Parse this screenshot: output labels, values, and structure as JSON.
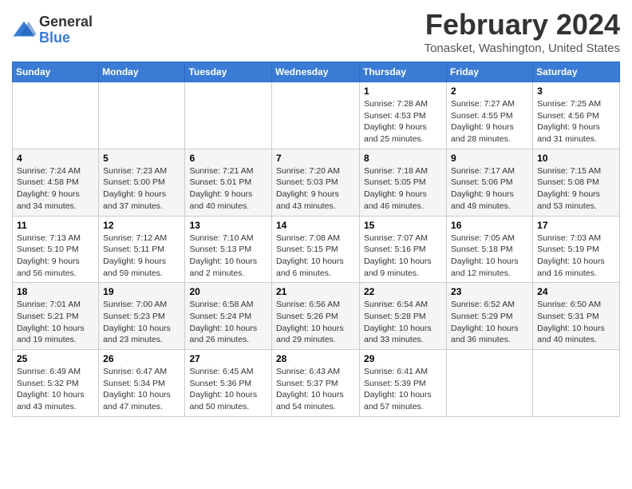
{
  "header": {
    "logo_general": "General",
    "logo_blue": "Blue",
    "month_title": "February 2024",
    "location": "Tonasket, Washington, United States"
  },
  "weekdays": [
    "Sunday",
    "Monday",
    "Tuesday",
    "Wednesday",
    "Thursday",
    "Friday",
    "Saturday"
  ],
  "weeks": [
    [
      {
        "day": "",
        "sunrise": "",
        "sunset": "",
        "daylight": ""
      },
      {
        "day": "",
        "sunrise": "",
        "sunset": "",
        "daylight": ""
      },
      {
        "day": "",
        "sunrise": "",
        "sunset": "",
        "daylight": ""
      },
      {
        "day": "",
        "sunrise": "",
        "sunset": "",
        "daylight": ""
      },
      {
        "day": "1",
        "sunrise": "Sunrise: 7:28 AM",
        "sunset": "Sunset: 4:53 PM",
        "daylight": "Daylight: 9 hours and 25 minutes."
      },
      {
        "day": "2",
        "sunrise": "Sunrise: 7:27 AM",
        "sunset": "Sunset: 4:55 PM",
        "daylight": "Daylight: 9 hours and 28 minutes."
      },
      {
        "day": "3",
        "sunrise": "Sunrise: 7:25 AM",
        "sunset": "Sunset: 4:56 PM",
        "daylight": "Daylight: 9 hours and 31 minutes."
      }
    ],
    [
      {
        "day": "4",
        "sunrise": "Sunrise: 7:24 AM",
        "sunset": "Sunset: 4:58 PM",
        "daylight": "Daylight: 9 hours and 34 minutes."
      },
      {
        "day": "5",
        "sunrise": "Sunrise: 7:23 AM",
        "sunset": "Sunset: 5:00 PM",
        "daylight": "Daylight: 9 hours and 37 minutes."
      },
      {
        "day": "6",
        "sunrise": "Sunrise: 7:21 AM",
        "sunset": "Sunset: 5:01 PM",
        "daylight": "Daylight: 9 hours and 40 minutes."
      },
      {
        "day": "7",
        "sunrise": "Sunrise: 7:20 AM",
        "sunset": "Sunset: 5:03 PM",
        "daylight": "Daylight: 9 hours and 43 minutes."
      },
      {
        "day": "8",
        "sunrise": "Sunrise: 7:18 AM",
        "sunset": "Sunset: 5:05 PM",
        "daylight": "Daylight: 9 hours and 46 minutes."
      },
      {
        "day": "9",
        "sunrise": "Sunrise: 7:17 AM",
        "sunset": "Sunset: 5:06 PM",
        "daylight": "Daylight: 9 hours and 49 minutes."
      },
      {
        "day": "10",
        "sunrise": "Sunrise: 7:15 AM",
        "sunset": "Sunset: 5:08 PM",
        "daylight": "Daylight: 9 hours and 53 minutes."
      }
    ],
    [
      {
        "day": "11",
        "sunrise": "Sunrise: 7:13 AM",
        "sunset": "Sunset: 5:10 PM",
        "daylight": "Daylight: 9 hours and 56 minutes."
      },
      {
        "day": "12",
        "sunrise": "Sunrise: 7:12 AM",
        "sunset": "Sunset: 5:11 PM",
        "daylight": "Daylight: 9 hours and 59 minutes."
      },
      {
        "day": "13",
        "sunrise": "Sunrise: 7:10 AM",
        "sunset": "Sunset: 5:13 PM",
        "daylight": "Daylight: 10 hours and 2 minutes."
      },
      {
        "day": "14",
        "sunrise": "Sunrise: 7:08 AM",
        "sunset": "Sunset: 5:15 PM",
        "daylight": "Daylight: 10 hours and 6 minutes."
      },
      {
        "day": "15",
        "sunrise": "Sunrise: 7:07 AM",
        "sunset": "Sunset: 5:16 PM",
        "daylight": "Daylight: 10 hours and 9 minutes."
      },
      {
        "day": "16",
        "sunrise": "Sunrise: 7:05 AM",
        "sunset": "Sunset: 5:18 PM",
        "daylight": "Daylight: 10 hours and 12 minutes."
      },
      {
        "day": "17",
        "sunrise": "Sunrise: 7:03 AM",
        "sunset": "Sunset: 5:19 PM",
        "daylight": "Daylight: 10 hours and 16 minutes."
      }
    ],
    [
      {
        "day": "18",
        "sunrise": "Sunrise: 7:01 AM",
        "sunset": "Sunset: 5:21 PM",
        "daylight": "Daylight: 10 hours and 19 minutes."
      },
      {
        "day": "19",
        "sunrise": "Sunrise: 7:00 AM",
        "sunset": "Sunset: 5:23 PM",
        "daylight": "Daylight: 10 hours and 23 minutes."
      },
      {
        "day": "20",
        "sunrise": "Sunrise: 6:58 AM",
        "sunset": "Sunset: 5:24 PM",
        "daylight": "Daylight: 10 hours and 26 minutes."
      },
      {
        "day": "21",
        "sunrise": "Sunrise: 6:56 AM",
        "sunset": "Sunset: 5:26 PM",
        "daylight": "Daylight: 10 hours and 29 minutes."
      },
      {
        "day": "22",
        "sunrise": "Sunrise: 6:54 AM",
        "sunset": "Sunset: 5:28 PM",
        "daylight": "Daylight: 10 hours and 33 minutes."
      },
      {
        "day": "23",
        "sunrise": "Sunrise: 6:52 AM",
        "sunset": "Sunset: 5:29 PM",
        "daylight": "Daylight: 10 hours and 36 minutes."
      },
      {
        "day": "24",
        "sunrise": "Sunrise: 6:50 AM",
        "sunset": "Sunset: 5:31 PM",
        "daylight": "Daylight: 10 hours and 40 minutes."
      }
    ],
    [
      {
        "day": "25",
        "sunrise": "Sunrise: 6:49 AM",
        "sunset": "Sunset: 5:32 PM",
        "daylight": "Daylight: 10 hours and 43 minutes."
      },
      {
        "day": "26",
        "sunrise": "Sunrise: 6:47 AM",
        "sunset": "Sunset: 5:34 PM",
        "daylight": "Daylight: 10 hours and 47 minutes."
      },
      {
        "day": "27",
        "sunrise": "Sunrise: 6:45 AM",
        "sunset": "Sunset: 5:36 PM",
        "daylight": "Daylight: 10 hours and 50 minutes."
      },
      {
        "day": "28",
        "sunrise": "Sunrise: 6:43 AM",
        "sunset": "Sunset: 5:37 PM",
        "daylight": "Daylight: 10 hours and 54 minutes."
      },
      {
        "day": "29",
        "sunrise": "Sunrise: 6:41 AM",
        "sunset": "Sunset: 5:39 PM",
        "daylight": "Daylight: 10 hours and 57 minutes."
      },
      {
        "day": "",
        "sunrise": "",
        "sunset": "",
        "daylight": ""
      },
      {
        "day": "",
        "sunrise": "",
        "sunset": "",
        "daylight": ""
      }
    ]
  ]
}
